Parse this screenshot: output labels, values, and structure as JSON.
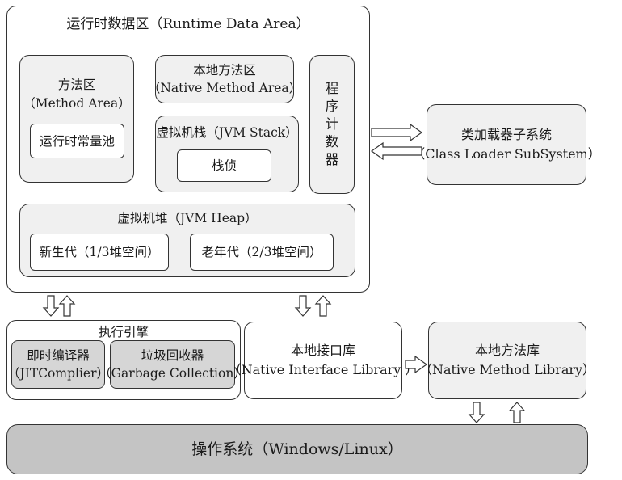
{
  "runtime": {
    "title": "运行时数据区（Runtime Data Area）",
    "method_area": {
      "name": "方法区",
      "en": "（Method Area）",
      "pool": "运行时常量池"
    },
    "native_method_area": {
      "name": "本地方法区",
      "en": "（Native Method Area）"
    },
    "jvm_stack": {
      "title": "虚拟机栈（JVM Stack）",
      "frame": "栈侦"
    },
    "pc_register": [
      "程",
      "序",
      "计",
      "数",
      "器"
    ],
    "heap": {
      "title": "虚拟机堆（JVM Heap）",
      "young": "新生代（1/3堆空间）",
      "old": "老年代（2/3堆空间）"
    }
  },
  "class_loader": {
    "name": "类加载器子系统",
    "en": "（Class Loader SubSystem）"
  },
  "engine": {
    "title": "执行引擎",
    "jit": {
      "name": "即时编译器",
      "en": "（JITComplier）"
    },
    "gc": {
      "name": "垃圾回收器",
      "en": "（Garbage Collection）"
    }
  },
  "native_interface": {
    "name": "本地接口库",
    "en": "（Native Interface Library ）"
  },
  "native_library": {
    "name": "本地方法库",
    "en": "（Native Method Library）"
  },
  "os": {
    "label": "操作系统（Windows/Linux）"
  },
  "colors": {
    "panel": "#f0f0f0",
    "inner": "#ffffff",
    "engine_inner": "#d6d6d6",
    "os": "#c4c4c4",
    "stroke": "#333333"
  }
}
